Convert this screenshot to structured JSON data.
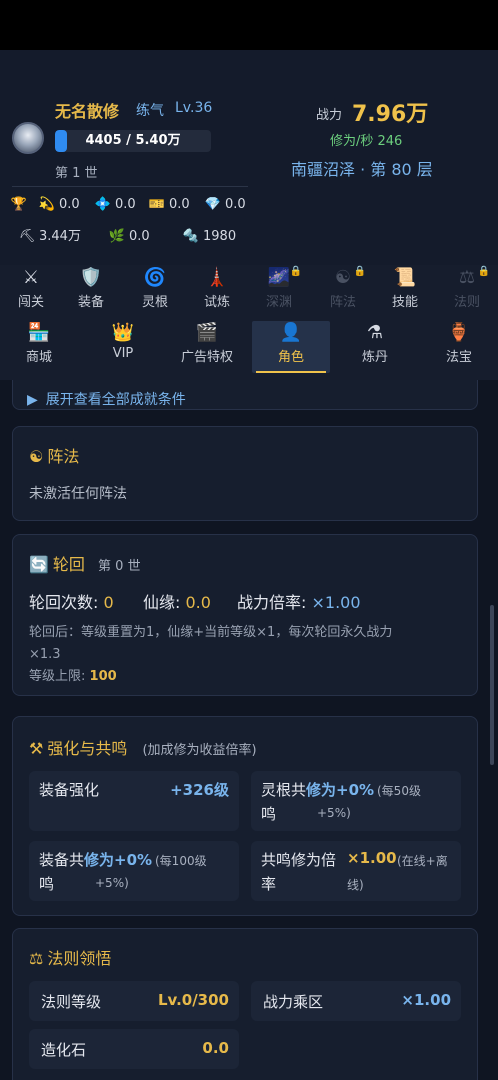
{
  "player": {
    "name": "无名散修",
    "realm": "练气",
    "level": "Lv.36",
    "exp_text": "4405 / 5.40万",
    "exp_fraction": 0.08,
    "life": "第 1 世"
  },
  "power": {
    "label": "战力",
    "value": "7.96万",
    "rate": "修为/秒 246",
    "location": "南疆沼泽 · 第 80 层"
  },
  "resources_row1": [
    {
      "icon": "trophy-icon",
      "glyph": "🏆",
      "value": ""
    },
    {
      "icon": "spirit-icon",
      "glyph": "💫",
      "value": "0.0"
    },
    {
      "icon": "crystal-icon",
      "glyph": "💠",
      "value": "0.0"
    },
    {
      "icon": "ticket-icon",
      "glyph": "🎫",
      "value": "0.0"
    },
    {
      "icon": "diamond-icon",
      "glyph": "💎",
      "value": "0.0"
    }
  ],
  "resources_row2": [
    {
      "icon": "pickaxe-icon",
      "glyph": "⛏",
      "value": "3.44万"
    },
    {
      "icon": "herb-icon",
      "glyph": "🌿",
      "value": "0.0"
    },
    {
      "icon": "ore-icon",
      "glyph": "🔩",
      "value": "1980"
    }
  ],
  "tabs_row1": [
    {
      "name": "tab-challenge",
      "icon": "swords-icon",
      "glyph": "⚔",
      "label": "闯关",
      "locked": false
    },
    {
      "name": "tab-equipment",
      "icon": "shield-icon",
      "glyph": "🛡️",
      "label": "装备",
      "locked": false
    },
    {
      "name": "tab-spirit-root",
      "icon": "spiral-icon",
      "glyph": "🌀",
      "label": "灵根",
      "locked": false
    },
    {
      "name": "tab-trial",
      "icon": "tower-icon",
      "glyph": "🗼",
      "label": "试炼",
      "locked": false
    },
    {
      "name": "tab-abyss",
      "icon": "abyss-icon",
      "glyph": "🌌",
      "label": "深渊",
      "locked": true
    },
    {
      "name": "tab-formation",
      "icon": "yinyang-icon",
      "glyph": "☯",
      "label": "阵法",
      "locked": true
    },
    {
      "name": "tab-skills",
      "icon": "scroll-icon",
      "glyph": "📜",
      "label": "技能",
      "locked": false
    },
    {
      "name": "tab-law",
      "icon": "scales-icon",
      "glyph": "⚖",
      "label": "法则",
      "locked": true
    }
  ],
  "tabs_row2": [
    {
      "name": "tab-shop",
      "icon": "store-icon",
      "glyph": "🏪",
      "label": "商城",
      "active": false
    },
    {
      "name": "tab-vip",
      "icon": "crown-icon",
      "glyph": "👑",
      "label": "VIP",
      "active": false
    },
    {
      "name": "tab-ad-privilege",
      "icon": "clapper-icon",
      "glyph": "🎬",
      "label": "广告特权",
      "active": false
    },
    {
      "name": "tab-character",
      "icon": "person-icon",
      "glyph": "👤",
      "label": "角色",
      "active": true
    },
    {
      "name": "tab-alchemy",
      "icon": "flask-icon",
      "glyph": "⚗",
      "label": "炼丹",
      "active": false
    },
    {
      "name": "tab-treasure",
      "icon": "vase-icon",
      "glyph": "🏺",
      "label": "法宝",
      "active": false
    }
  ],
  "expand_link": "展开查看全部成就条件",
  "formation": {
    "icon_glyph": "☯",
    "title": "阵法",
    "text": "未激活任何阵法"
  },
  "reincarnation": {
    "icon_glyph": "🔄",
    "title": "轮回",
    "sub": "第 0 世",
    "count_label": "轮回次数:",
    "count_value": "0",
    "fate_label": "仙缘:",
    "fate_value": "0.0",
    "mult_label": "战力倍率:",
    "mult_value": "×1.00",
    "note1": "轮回后：等级重置为1，仙缘+当前等级×1，每次轮回永久战力",
    "note2": "×1.3",
    "cap_label": "等级上限:",
    "cap_value": "100"
  },
  "enhance": {
    "icon_glyph": "⚒",
    "title": "强化与共鸣",
    "sub": "(加成修为收益倍率)",
    "items": [
      {
        "label1": "装备强化",
        "label2": "",
        "value": "+326级",
        "note1": "",
        "note2": "",
        "color": "blue"
      },
      {
        "label1": "灵根共",
        "label2": "鸣",
        "value": "修为+0%",
        "note1": "(每50级",
        "note2": "+5%)",
        "color": "blue"
      },
      {
        "label1": "装备共",
        "label2": "鸣",
        "value": "修为+0%",
        "note1": "(每100级",
        "note2": "+5%)",
        "color": "blue"
      },
      {
        "label1": "共鸣修为倍",
        "label2": "率",
        "value": "×1.00",
        "note1": "(在线+离",
        "note2": "线)",
        "color": "gold"
      }
    ]
  },
  "law": {
    "icon_glyph": "⚖",
    "title": "法则领悟",
    "rows": [
      {
        "label": "法则等级",
        "value": "Lv.0/300",
        "color": "gold"
      },
      {
        "label": "战力乘区",
        "value": "×1.00",
        "color": "blue"
      },
      {
        "label": "造化石",
        "value": "0.0",
        "color": "gold"
      }
    ]
  }
}
